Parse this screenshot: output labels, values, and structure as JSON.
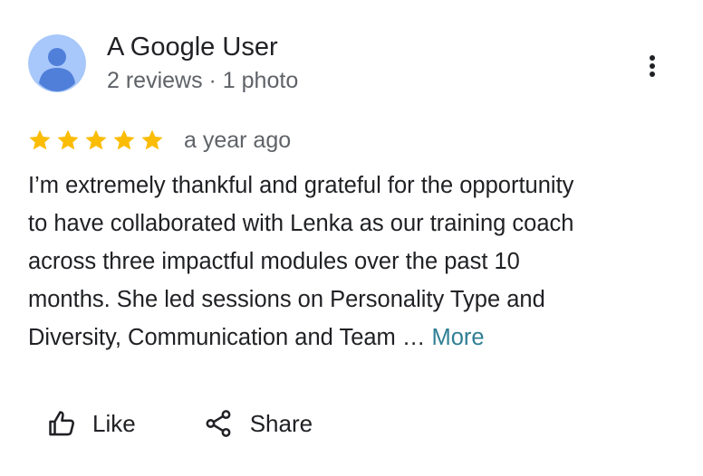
{
  "review": {
    "author": {
      "name": "A Google User",
      "meta": "2 reviews · 1 photo",
      "avatar_icon": "user-avatar-icon",
      "avatar_bg": "#a8c7fa",
      "avatar_fg": "#4f7fd9"
    },
    "menu_icon": "more-vert-icon",
    "rating": {
      "stars": 5,
      "max": 5,
      "star_color": "#fbbc04"
    },
    "date": "a year ago",
    "text_lines": [
      "I’m extremely thankful and grateful for the opportunity",
      "to have collaborated with Lenka as our training coach",
      "across three impactful modules over the past 10",
      "months. She led sessions on Personality Type and",
      "Diversity, Communication and Team … "
    ],
    "more_label": "More",
    "actions": {
      "like_label": "Like",
      "like_icon": "thumbs-up-icon",
      "share_label": "Share",
      "share_icon": "share-icon"
    }
  }
}
